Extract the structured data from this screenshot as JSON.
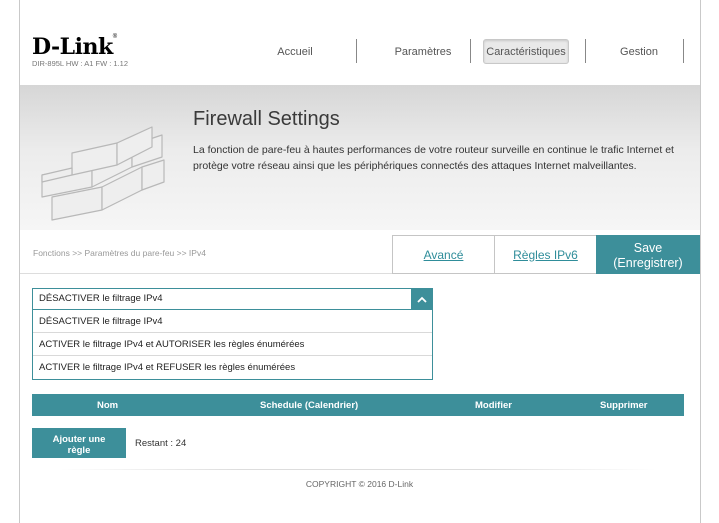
{
  "header": {
    "logo": "D-Link",
    "logo_mark": "®",
    "model_info": "DIR-895L   HW : A1   FW : 1.12"
  },
  "nav": {
    "items": [
      "Accueil",
      "Paramètres",
      "Caractéristiques",
      "Gestion"
    ],
    "active": "Caractéristiques"
  },
  "banner": {
    "title": "Firewall Settings",
    "description": "La fonction de pare-feu à hautes performances de votre routeur surveille en continue le trafic Internet et protège votre réseau ainsi que les périphériques connectés des attaques Internet malveillantes."
  },
  "breadcrumb": "Fonctions >> Paramètres du pare-feu >> IPv4",
  "tabs": {
    "advanced": "Avancé",
    "ipv6_rules": "Règles IPv6",
    "save_line1": "Save",
    "save_line2": "(Enregistrer)"
  },
  "filter": {
    "selected": "DÉSACTIVER le filtrage IPv4",
    "options": [
      "DÉSACTIVER le filtrage IPv4",
      "ACTIVER le filtrage IPv4 et AUTORISER les règles énumérées",
      "ACTIVER le filtrage IPv4 et REFUSER les règles énumérées"
    ]
  },
  "table": {
    "columns": [
      "Nom",
      "Schedule (Calendrier)",
      "Modifier",
      "Supprimer"
    ]
  },
  "add_rule": {
    "label_line1": "Ajouter une",
    "label_line2": "règle",
    "remaining": "Restant : 24"
  },
  "footer": {
    "copyright": "COPYRIGHT © 2016 D-Link"
  },
  "colors": {
    "accent": "#3d8f9a",
    "link": "#2f8d9a"
  }
}
